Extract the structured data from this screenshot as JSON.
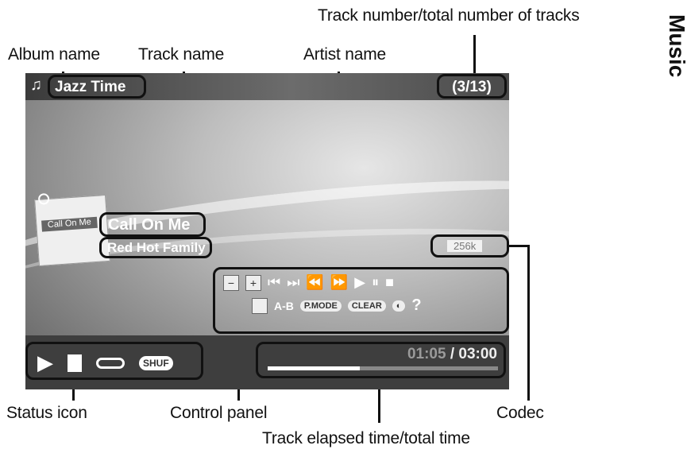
{
  "side_label": "Music",
  "callouts": {
    "track_number": "Track number/total number of tracks",
    "album": "Album name",
    "track": "Track name",
    "artist": "Artist name",
    "status": "Status icon",
    "control": "Control panel",
    "codec": "Codec",
    "elapsed": "Track elapsed time/total time"
  },
  "player": {
    "album_name": "Jazz Time",
    "track_counter": "(3/13)",
    "track_name": "Call On Me",
    "artist_name": "Red Hot Family",
    "cover_text": "Call On Me",
    "codec": "256k",
    "elapsed": "01:05",
    "separator": "/",
    "total": "03:00",
    "progress_fraction": 0.4
  },
  "controls": {
    "row1": [
      "−",
      "+",
      "⏮",
      "⏭",
      "⏪",
      "⏩",
      "▶",
      "⏸",
      "■"
    ],
    "ab": "A-B",
    "pmode": "P.MODE",
    "clear": "CLEAR",
    "help": "?"
  },
  "status": {
    "shuffle": "SHUF"
  }
}
